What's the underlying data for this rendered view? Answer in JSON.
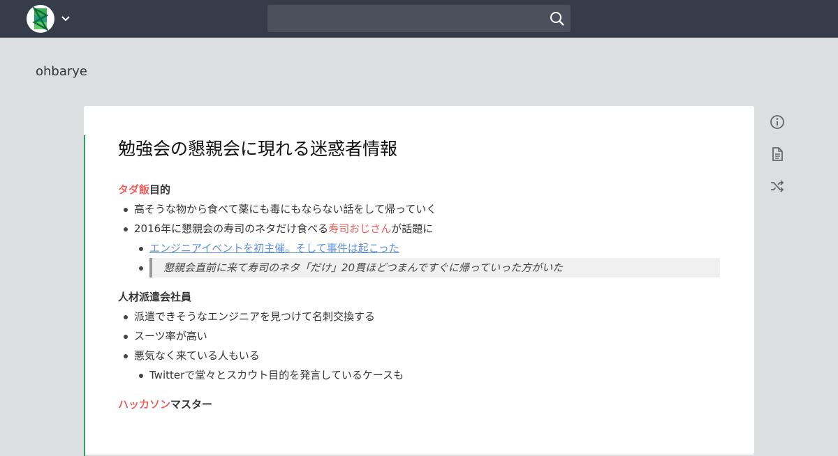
{
  "topbar": {
    "search_placeholder": "",
    "logo_icon": "scrapbox-logo-icon",
    "menu_icon": "chevron-down-icon",
    "search_icon": "search-icon"
  },
  "project": {
    "name": "ohbarye"
  },
  "page": {
    "title": "勉強会の懇親会に現れる迷惑者情報",
    "sections": {
      "s1": {
        "heading_red": "タダ飯",
        "heading_rest": "目的",
        "item1": "高そうな物から食べて薬にも毒にもならない話をして帰っていく",
        "item2_pre": "2016年に懇親会の寿司のネタだけ食べる",
        "item2_red": "寿司おじさん",
        "item2_post": "が話題に",
        "sub_link": "エンジニアイベントを初主催。そして事件は起こった",
        "sub_quote": "懇親会直前に来て寿司のネタ「だけ」20貫ほどつまんですぐに帰っていった方がいた"
      },
      "s2": {
        "heading": "人材派遣会社員",
        "item1": "派遣できそうなエンジニアを見つけて名刺交換する",
        "item2": "スーツ率が高い",
        "item3": "悪気なく来ている人もいる",
        "sub1": "Twitterで堂々とスカウト目的を発言しているケースも"
      },
      "s3": {
        "heading_red": "ハッカソン",
        "heading_rest": "マスター"
      }
    }
  },
  "side_icons": [
    "info-icon",
    "document-icon",
    "shuffle-icon"
  ],
  "colors": {
    "topbar": "#363c4a",
    "accent_red": "#f0625e",
    "link": "#5c8fe0",
    "logo_green": "#2d9e67"
  }
}
